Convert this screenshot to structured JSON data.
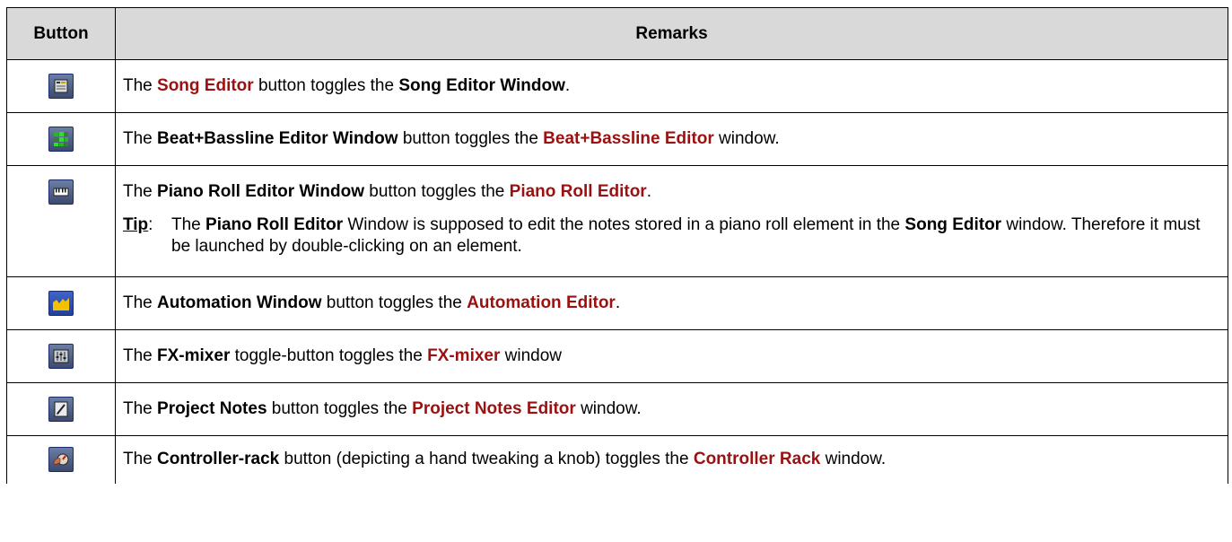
{
  "header": {
    "button": "Button",
    "remarks": "Remarks"
  },
  "rows": [
    {
      "icon": "song-editor-icon",
      "parts": [
        "The ",
        "Song Editor",
        " button toggles the ",
        "Song Editor Window",
        "."
      ]
    },
    {
      "icon": "beat-bassline-editor-icon",
      "parts": [
        "The ",
        "Beat+Bassline Editor Window",
        " button toggles the ",
        "Beat+Bassline Editor",
        " window."
      ]
    },
    {
      "icon": "piano-roll-icon",
      "parts": [
        "The ",
        "Piano Roll Editor Window",
        " button toggles the ",
        "Piano Roll Editor",
        "."
      ],
      "tip": {
        "label": "Tip",
        "colon": ":",
        "parts": [
          "The ",
          "Piano Roll Editor",
          " Window is supposed to edit the notes stored in a piano roll element in the ",
          "Song Editor",
          " window. Therefore it must be launched by double-clicking on an element."
        ]
      }
    },
    {
      "icon": "automation-icon",
      "parts": [
        "The ",
        "Automation Window",
        " button toggles the ",
        "Automation Editor",
        "."
      ]
    },
    {
      "icon": "fx-mixer-icon",
      "parts": [
        "The ",
        "FX-mixer",
        " toggle-button toggles the ",
        "FX-mixer",
        " window"
      ]
    },
    {
      "icon": "project-notes-icon",
      "parts": [
        "The ",
        "Project Notes",
        " button toggles the ",
        "Project Notes Editor",
        " window."
      ]
    },
    {
      "icon": "controller-rack-icon",
      "parts": [
        "The ",
        "Controller-rack",
        " button (depicting a hand tweaking a knob) toggles the ",
        "Controller Rack",
        " window."
      ]
    }
  ],
  "colors": {
    "link": "#9b1010",
    "header_bg": "#d9d9d9",
    "border": "#000000"
  }
}
